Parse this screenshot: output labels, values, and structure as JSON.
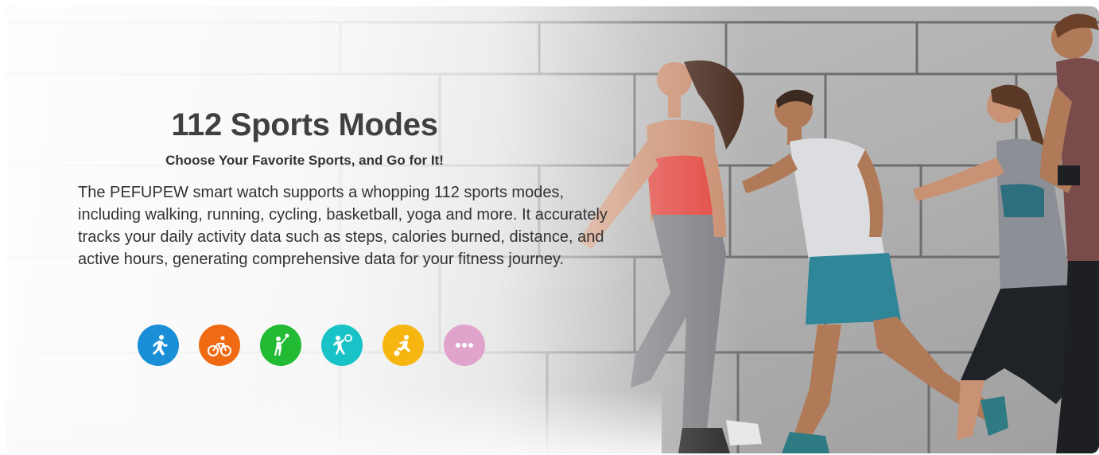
{
  "headline": "112 Sports Modes",
  "subheadline": "Choose Your Favorite Sports, and Go for It!",
  "description": "The PEFUPEW smart watch supports a whopping 112 sports modes, including walking, running, cycling, basketball, yoga and more. It accurately tracks your daily activity data such as steps, calories burned, distance, and active hours, generating comprehensive data for your fitness journey.",
  "sport_icons": [
    {
      "icon": "running-icon",
      "color": "#1a8fd8"
    },
    {
      "icon": "cycling-icon",
      "color": "#f06a14"
    },
    {
      "icon": "badminton-icon",
      "color": "#22bb33"
    },
    {
      "icon": "basketball-icon",
      "color": "#17c3c6"
    },
    {
      "icon": "football-icon",
      "color": "#f6b60f"
    },
    {
      "icon": "more-icon",
      "color": "#e0a3cc"
    }
  ]
}
